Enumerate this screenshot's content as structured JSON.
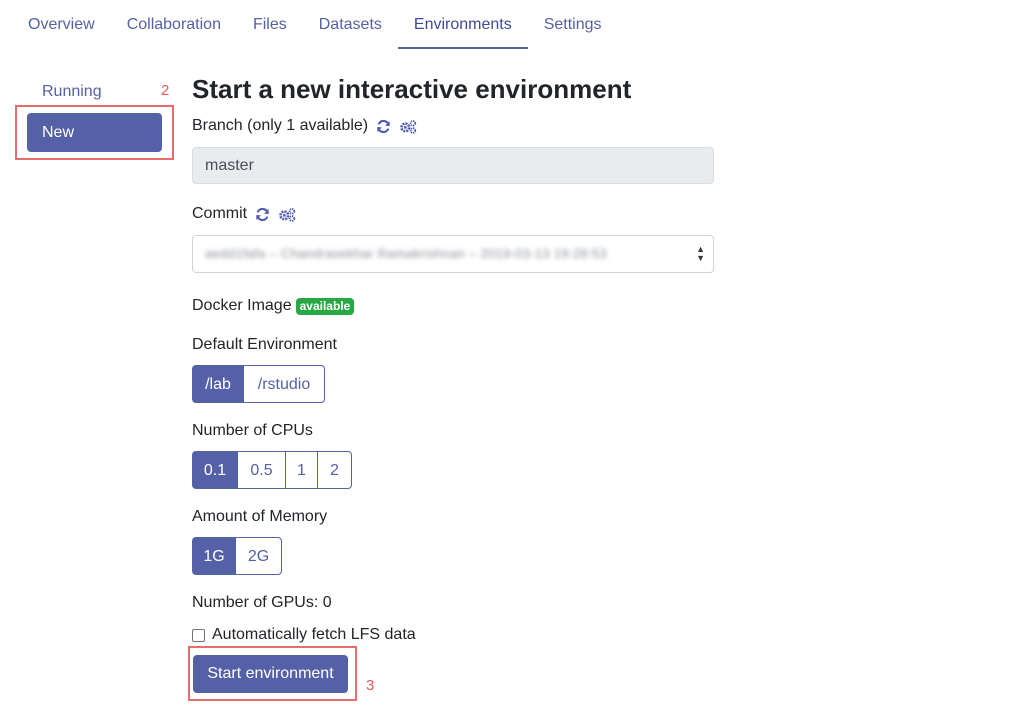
{
  "tabs": [
    {
      "label": "Overview"
    },
    {
      "label": "Collaboration"
    },
    {
      "label": "Files"
    },
    {
      "label": "Datasets"
    },
    {
      "label": "Environments",
      "active": true
    },
    {
      "label": "Settings"
    }
  ],
  "sidebar": {
    "running_label": "Running",
    "new_label": "New"
  },
  "annotations": {
    "n2": "2",
    "n3": "3"
  },
  "form": {
    "title": "Start a new interactive environment",
    "branch": {
      "label": "Branch (only 1 available)",
      "value": "master"
    },
    "commit": {
      "label": "Commit",
      "selected": "aedd1fafa – Chandrasekhar Ramakrishnan – 2019-03-13 19:28:53"
    },
    "docker": {
      "label": "Docker Image",
      "badge": "available"
    },
    "default_env": {
      "label": "Default Environment",
      "options": [
        "/lab",
        "/rstudio"
      ],
      "selected": "/lab"
    },
    "cpus": {
      "label": "Number of CPUs",
      "options": [
        "0.1",
        "0.5",
        "1",
        "2"
      ],
      "selected": "0.1"
    },
    "memory": {
      "label": "Amount of Memory",
      "options": [
        "1G",
        "2G"
      ],
      "selected": "1G"
    },
    "gpus": {
      "label": "Number of GPUs: 0"
    },
    "lfs": {
      "label": "Automatically fetch LFS data",
      "checked": false
    },
    "start_label": "Start environment"
  },
  "colors": {
    "accent": "#5561a6",
    "badge": "#28a745",
    "annotation": "#e96b6b"
  },
  "icons": {
    "refresh": "refresh-icon",
    "settings": "cogs-icon"
  }
}
